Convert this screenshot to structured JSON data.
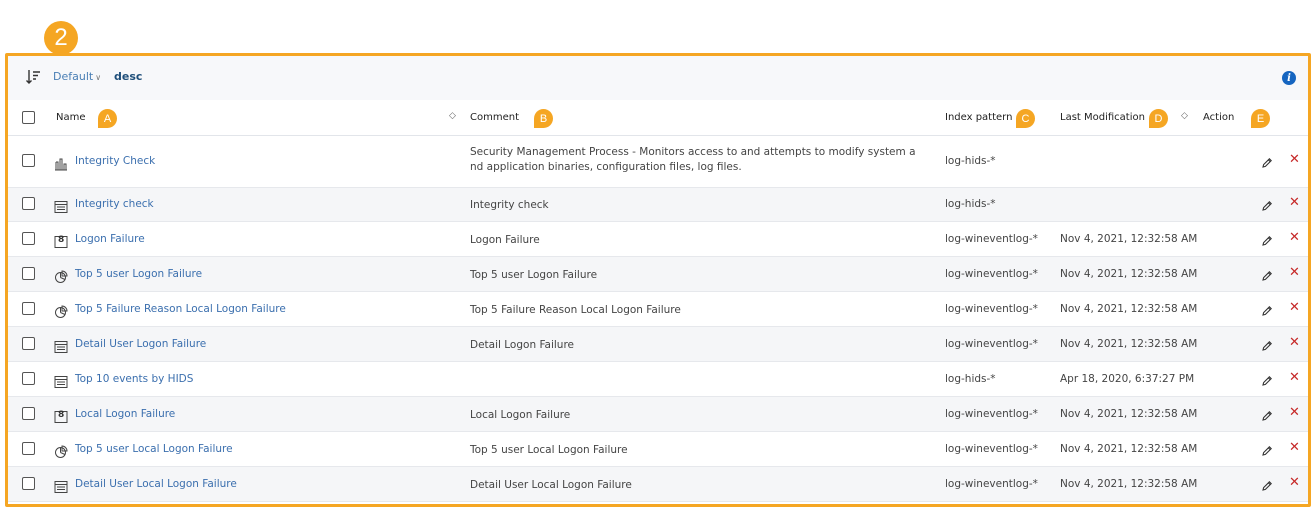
{
  "callouts": {
    "main": "2",
    "a": "A",
    "b": "B",
    "c": "C",
    "d": "D",
    "e": "E"
  },
  "toolbar": {
    "sort_field": "Default",
    "sort_direction": "desc",
    "info_label": "i"
  },
  "columns": {
    "name": "Name",
    "comment": "Comment",
    "index_pattern": "Index pattern",
    "last_modification": "Last Modification",
    "action": "Action",
    "sort_caret": "◇"
  },
  "colors": {
    "accent": "#f5a623",
    "link": "#3b6fae",
    "delete": "#c62828",
    "info": "#1565c0"
  },
  "rows": [
    {
      "icon": "bar-chart-icon",
      "name": "Integrity Check",
      "comment": "Security Management Process - Monitors access to and attempts to modify system a nd application binaries, configuration files, log files.",
      "index": "log-hids-*",
      "modified": ""
    },
    {
      "icon": "table-icon",
      "name": "Integrity check",
      "comment": "Integrity check",
      "index": "log-hids-*",
      "modified": ""
    },
    {
      "icon": "metric-icon",
      "name": "Logon Failure",
      "comment": "Logon Failure",
      "index": "log-wineventlog-*",
      "modified": "Nov 4, 2021, 12:32:58 AM"
    },
    {
      "icon": "pie-chart-icon",
      "name": "Top 5 user Logon Failure",
      "comment": "Top 5 user Logon Failure",
      "index": "log-wineventlog-*",
      "modified": "Nov 4, 2021, 12:32:58 AM"
    },
    {
      "icon": "pie-chart-icon",
      "name": "Top 5 Failure Reason Local Logon Failure",
      "comment": "Top 5 Failure Reason Local Logon Failure",
      "index": "log-wineventlog-*",
      "modified": "Nov 4, 2021, 12:32:58 AM"
    },
    {
      "icon": "table-icon",
      "name": "Detail User Logon Failure",
      "comment": "Detail Logon Failure",
      "index": "log-wineventlog-*",
      "modified": "Nov 4, 2021, 12:32:58 AM"
    },
    {
      "icon": "table-icon",
      "name": "Top 10 events by HIDS",
      "comment": "",
      "index": "log-hids-*",
      "modified": "Apr 18, 2020, 6:37:27 PM"
    },
    {
      "icon": "metric-icon",
      "name": "Local Logon Failure",
      "comment": "Local Logon Failure",
      "index": "log-wineventlog-*",
      "modified": "Nov 4, 2021, 12:32:58 AM"
    },
    {
      "icon": "pie-chart-icon",
      "name": "Top 5 user Local Logon Failure",
      "comment": "Top 5 user Local Logon Failure",
      "index": "log-wineventlog-*",
      "modified": "Nov 4, 2021, 12:32:58 AM"
    },
    {
      "icon": "table-icon",
      "name": "Detail User Local Logon Failure",
      "comment": "Detail User Local Logon Failure",
      "index": "log-wineventlog-*",
      "modified": "Nov 4, 2021, 12:32:58 AM"
    }
  ],
  "metric_glyph": "8",
  "delete_glyph": "✕"
}
